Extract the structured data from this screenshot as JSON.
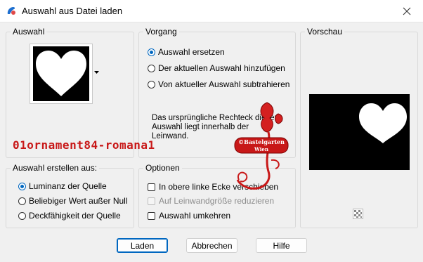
{
  "window": {
    "title": "Auswahl aus Datei laden",
    "close_icon": "close-icon",
    "app_icon": "paint-shop-icon"
  },
  "auswahl": {
    "label": "Auswahl",
    "thumbnail": "heart-shape"
  },
  "vorgang": {
    "label": "Vorgang",
    "options": [
      {
        "label": "Auswahl ersetzen",
        "checked": true
      },
      {
        "label": "Der aktuellen Auswahl hinzufügen",
        "checked": false
      },
      {
        "label": "Von aktueller Auswahl subtrahieren",
        "checked": false
      }
    ],
    "info": "Das ursprüngliche Rechteck dieser Auswahl liegt innerhalb der Leinwand."
  },
  "vorschau": {
    "label": "Vorschau"
  },
  "erstellen": {
    "label": "Auswahl erstellen aus:",
    "options": [
      {
        "label": "Luminanz der Quelle",
        "checked": true
      },
      {
        "label": "Beliebiger Wert außer Null",
        "checked": false
      },
      {
        "label": "Deckfähigkeit der Quelle",
        "checked": false
      }
    ]
  },
  "optionen": {
    "label": "Optionen",
    "options": [
      {
        "label": "In obere linke Ecke verschieben",
        "checked": false,
        "disabled": false
      },
      {
        "label": "Auf Leinwandgröße reduzieren",
        "checked": false,
        "disabled": true
      },
      {
        "label": "Auswahl umkehren",
        "checked": false,
        "disabled": false
      }
    ]
  },
  "buttons": {
    "load": "Laden",
    "cancel": "Abbrechen",
    "help": "Hilfe"
  },
  "watermark": {
    "text": "01ornament84-romana1",
    "stamp_line1": "©Bastelgarten",
    "stamp_line2": "Wien"
  },
  "colors": {
    "accent": "#0067c0",
    "watermark": "#c81818"
  }
}
